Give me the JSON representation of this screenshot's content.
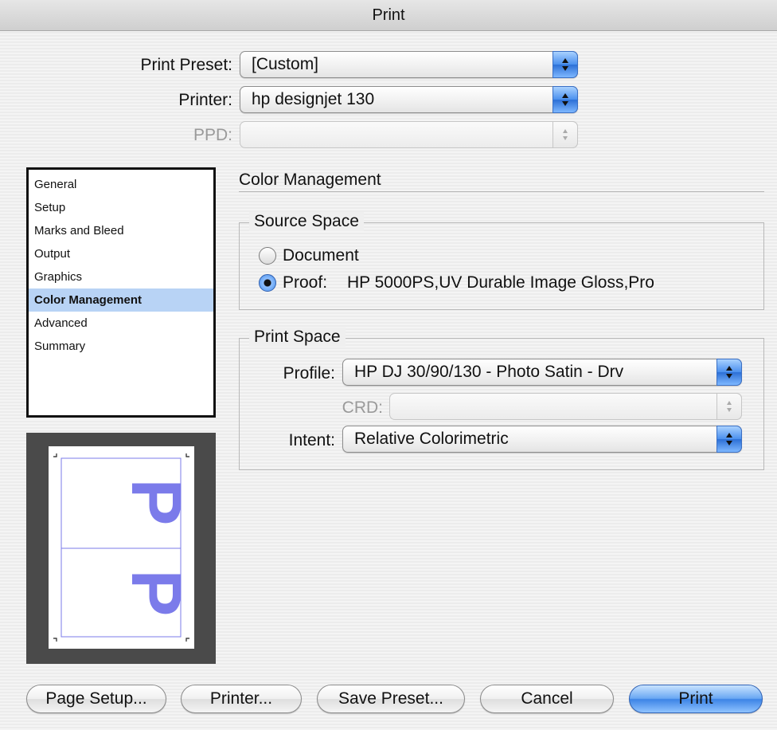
{
  "window": {
    "title": "Print"
  },
  "top": {
    "print_preset": {
      "label": "Print Preset:",
      "value": "[Custom]"
    },
    "printer": {
      "label": "Printer:",
      "value": "hp designjet 130"
    },
    "ppd": {
      "label": "PPD:",
      "value": ""
    }
  },
  "sidebar": {
    "items": [
      {
        "label": "General"
      },
      {
        "label": "Setup"
      },
      {
        "label": "Marks and Bleed"
      },
      {
        "label": "Output"
      },
      {
        "label": "Graphics"
      },
      {
        "label": "Color Management",
        "selected": true
      },
      {
        "label": "Advanced"
      },
      {
        "label": "Summary"
      }
    ]
  },
  "preview": {
    "glyph": "P"
  },
  "panel": {
    "title": "Color Management",
    "source_space": {
      "legend": "Source Space",
      "document_label": "Document",
      "proof_label": "Proof:",
      "proof_value": "HP 5000PS,UV Durable Image Gloss,Pro",
      "selected": "proof"
    },
    "print_space": {
      "legend": "Print Space",
      "profile": {
        "label": "Profile:",
        "value": "HP DJ 30/90/130 - Photo Satin - Drv"
      },
      "crd": {
        "label": "CRD:",
        "value": ""
      },
      "intent": {
        "label": "Intent:",
        "value": "Relative Colorimetric"
      }
    }
  },
  "buttons": {
    "page_setup": "Page Setup...",
    "printer": "Printer...",
    "save_preset": "Save Preset...",
    "cancel": "Cancel",
    "print": "Print"
  },
  "colors": {
    "selection": "#b8d3f5",
    "accent": "#3d84e6",
    "preview_glyph": "#7b7bea"
  },
  "icons": [
    "up-down-arrows-icon",
    "radio-button-icon",
    "crop-mark-icon"
  ]
}
